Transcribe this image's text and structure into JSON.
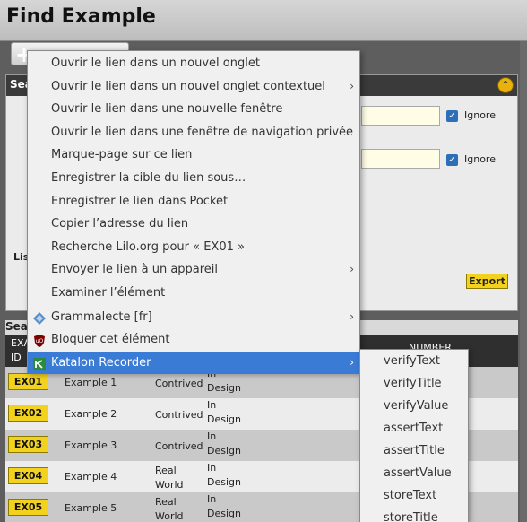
{
  "page": {
    "title": "Find Example"
  },
  "search_panel": {
    "header": "Search",
    "ignore_label": "Ignore",
    "list_label": "List",
    "export_label": "Export"
  },
  "results": {
    "title": "Search",
    "columns": {
      "id_line1": "EXAMPLE",
      "id_line2": "ID",
      "number": "NUMBER"
    },
    "rows": [
      {
        "id": "EX01",
        "name": "Example 1",
        "type": "Contrived",
        "status": "In Design"
      },
      {
        "id": "EX02",
        "name": "Example 2",
        "type": "Contrived",
        "status": "In Design"
      },
      {
        "id": "EX03",
        "name": "Example 3",
        "type": "Contrived",
        "status": "In Design"
      },
      {
        "id": "EX04",
        "name": "Example 4",
        "type": "Real World",
        "status": "In Design"
      },
      {
        "id": "EX05",
        "name": "Example 5",
        "type": "Real World",
        "status": "In Design"
      }
    ]
  },
  "context_menu": {
    "items": [
      {
        "label": "Ouvrir le lien dans un nouvel onglet",
        "submenu": false
      },
      {
        "label": "Ouvrir le lien dans un nouvel onglet contextuel",
        "submenu": true
      },
      {
        "label": "Ouvrir le lien dans une nouvelle fenêtre",
        "submenu": false
      },
      {
        "label": "Ouvrir le lien dans une fenêtre de navigation privée",
        "submenu": false
      },
      {
        "label": "Marque-page sur ce lien",
        "submenu": false
      },
      {
        "label": "Enregistrer la cible du lien sous…",
        "submenu": false
      },
      {
        "label": "Enregistrer le lien dans Pocket",
        "submenu": false
      },
      {
        "label": "Copier l’adresse du lien",
        "submenu": false
      },
      {
        "label": "Recherche Lilo.org pour « EX01 »",
        "submenu": false
      },
      {
        "label": "Envoyer le lien à un appareil",
        "submenu": true
      },
      {
        "label": "Examiner l’élément",
        "submenu": false
      },
      {
        "label": "Grammalecte [fr]",
        "submenu": true,
        "icon": "grammalecte-icon"
      },
      {
        "label": "Bloquer cet élément",
        "submenu": false,
        "icon": "ublock-icon"
      },
      {
        "label": "Katalon Recorder",
        "submenu": true,
        "icon": "katalon-icon",
        "active": true
      }
    ]
  },
  "katalon_submenu": {
    "items": [
      "verifyText",
      "verifyTitle",
      "verifyValue",
      "assertText",
      "assertTitle",
      "assertValue",
      "storeText",
      "storeTitle"
    ]
  },
  "colors": {
    "menu_highlight": "#3a7bd5",
    "id_button": "#f2d21f",
    "panel_header": "#3a3a3a"
  }
}
